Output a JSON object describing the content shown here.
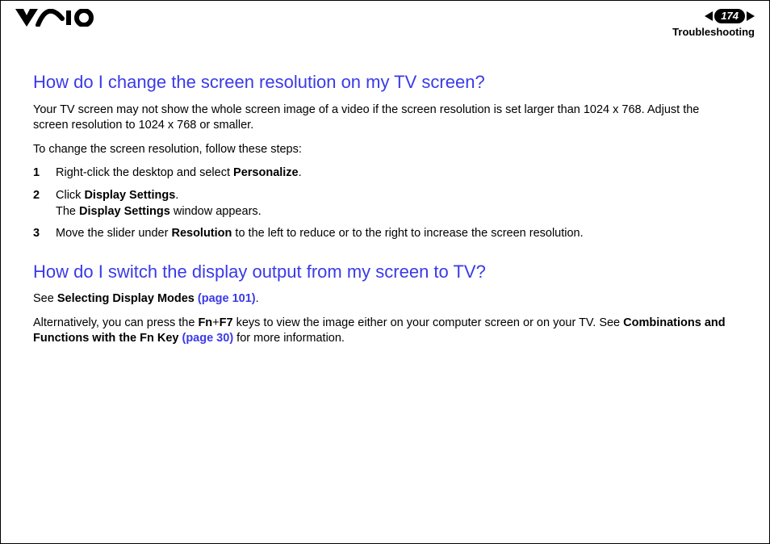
{
  "header": {
    "page_number": "174",
    "section": "Troubleshooting"
  },
  "section1": {
    "heading": "How do I change the screen resolution on my TV screen?",
    "intro": "Your TV screen may not show the whole screen image of a video if the screen resolution is set larger than 1024 x 768. Adjust the screen resolution to 1024 x 768 or smaller.",
    "lead": "To change the screen resolution, follow these steps:",
    "step1_a": "Right-click the desktop and select ",
    "step1_b": "Personalize",
    "step1_c": ".",
    "step2_a": "Click ",
    "step2_b": "Display Settings",
    "step2_c": ".",
    "step2_d": "The ",
    "step2_e": "Display Settings",
    "step2_f": " window appears.",
    "step3_a": "Move the slider under ",
    "step3_b": "Resolution",
    "step3_c": " to the left to reduce or to the right to increase the screen resolution."
  },
  "section2": {
    "heading": "How do I switch the display output from my screen to TV?",
    "p1_a": "See ",
    "p1_b": "Selecting Display Modes ",
    "p1_link": "(page 101)",
    "p1_c": ".",
    "p2_a": "Alternatively, you can press the ",
    "p2_b": "Fn",
    "p2_plus": "+",
    "p2_c": "F7",
    "p2_d": " keys to view the image either on your computer screen or on your TV. See ",
    "p2_e": "Combinations and Functions with the Fn Key ",
    "p2_link": "(page 30)",
    "p2_f": " for more information."
  }
}
